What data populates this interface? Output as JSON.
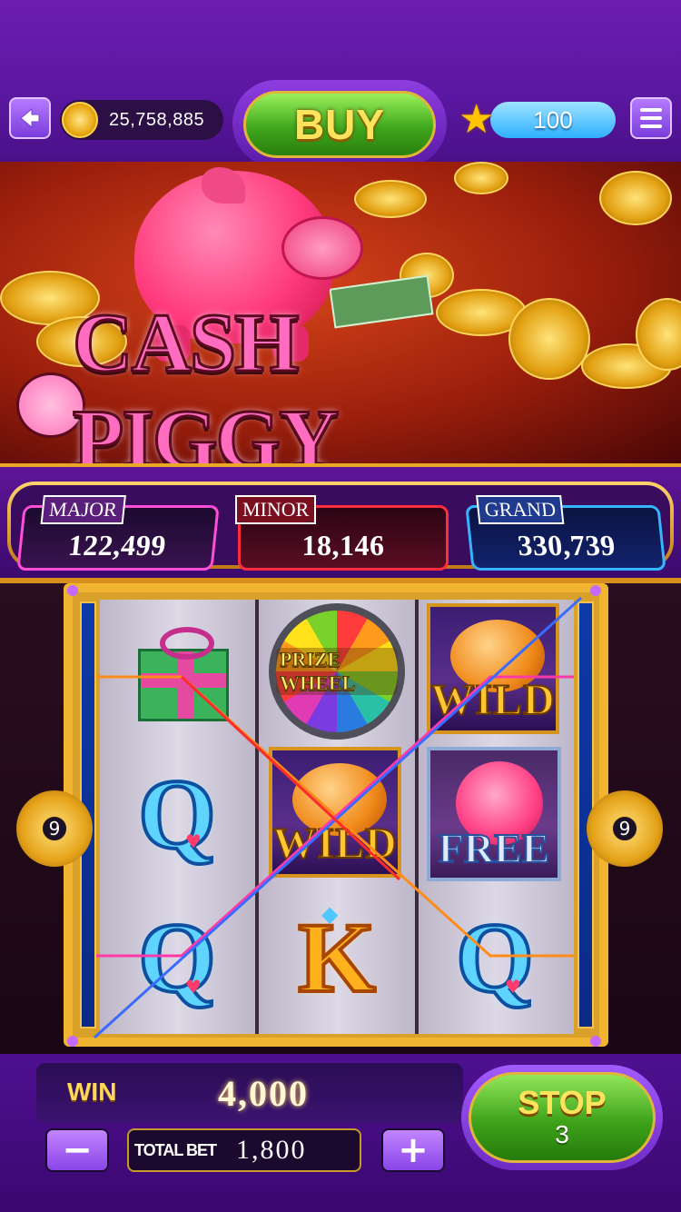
{
  "header": {
    "coins": "25,758,885",
    "buy_label": "BUY",
    "stars": "100"
  },
  "game": {
    "title": "CASH PIGGY"
  },
  "jackpots": [
    {
      "label": "MAJOR",
      "value": "122,499",
      "color": "#ff4fd9"
    },
    {
      "label": "MINOR",
      "value": "18,146",
      "color": "#ff2d3d"
    },
    {
      "label": "GRAND",
      "value": "330,739",
      "color": "#37b4ff"
    }
  ],
  "reels": {
    "line_count": "9",
    "symbols": {
      "prize_wheel": "PRIZE WHEEL",
      "wild": "WILD",
      "free": "FREE",
      "queen": "Q",
      "king": "K"
    },
    "grid": [
      [
        "gift",
        "prize_wheel",
        "wild"
      ],
      [
        "queen",
        "wild",
        "free"
      ],
      [
        "queen",
        "king",
        "queen"
      ]
    ]
  },
  "footer": {
    "win_label": "WIN",
    "win_value": "4,000",
    "total_bet_label": "TOTAL BET",
    "total_bet_value": "1,800",
    "minus_label": "−",
    "plus_label": "+",
    "stop_label": "STOP",
    "stop_count": "3"
  },
  "icons": {
    "back": "back-arrow-icon",
    "coin": "coin-icon",
    "star": "star-icon",
    "menu": "menu-icon"
  },
  "colors": {
    "purple_bg": "#5a17a0",
    "gold": "#f2b531",
    "green_button": "#3fa81c"
  }
}
